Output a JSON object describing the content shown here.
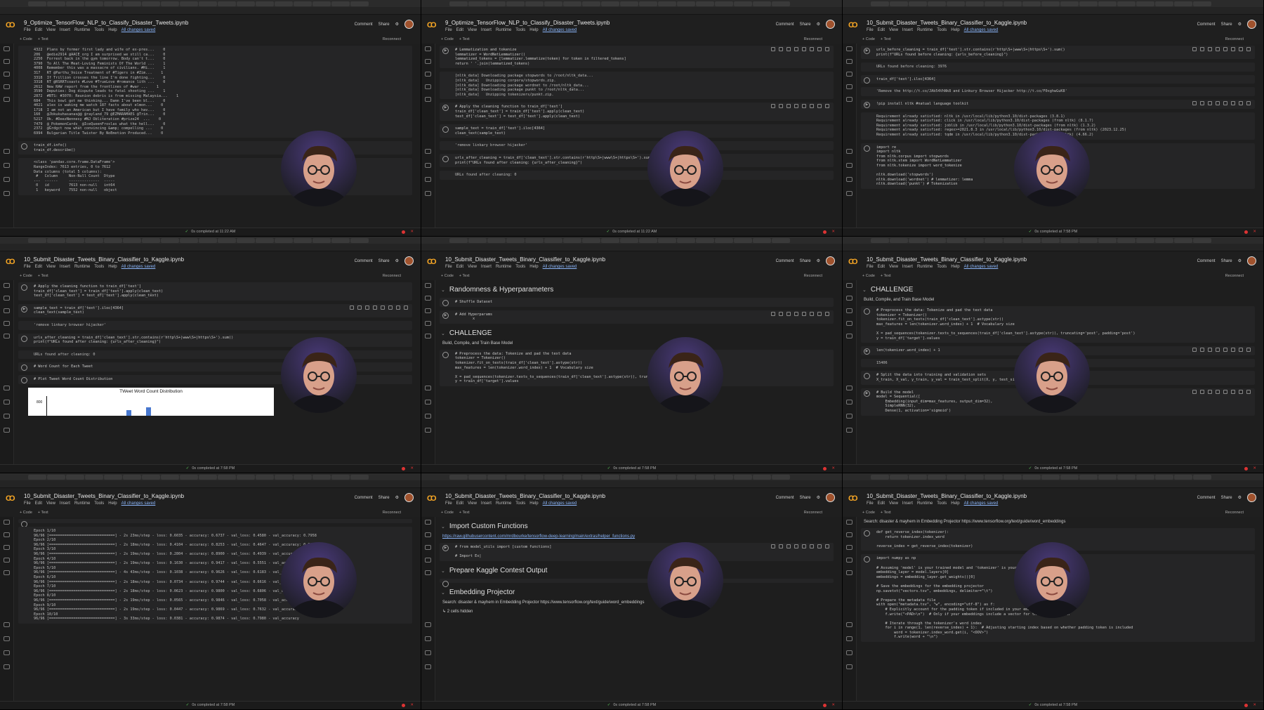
{
  "meta": {
    "screenshot": "grid of 9 Colab notebook windows"
  },
  "colors": {
    "accent_orange": "#f9a825",
    "link": "#8ab4f8",
    "status_ok": "#5fd35f",
    "status_error": "#d33333",
    "cam_bg": "#3a2a5a"
  },
  "common": {
    "menu": [
      "File",
      "Edit",
      "View",
      "Insert",
      "Runtime",
      "Tools",
      "Help"
    ],
    "saved": "All changes saved",
    "comment": "Comment",
    "share": "Share",
    "code_btn": "+ Code",
    "text_btn": "+ Text",
    "reconnect": "Reconnect"
  },
  "panels": [
    {
      "title": "9_Optimize_TensorFlow_NLP_to_Classify_Disaster_Tweets.ipynb",
      "status": "0s   completed at 11:22 AM",
      "cells": [
        {
          "type": "out",
          "text": "4322  Plans by former first lady and wife of ex-pres...    0\n206   @edie2914 @AACE_org I am surprised we still ca...    0\n2250  Forrest back in the gym tomorrow. Body can't t...    0\n3790  To All The Meat-Loving Feminists Of The World ...    1\n4008  Remember this was a massacre of civilians. #Hi...    1\n317   RT @Parthu_Voice Treatment of #Tigers in #Zim...    1\n3318  If Trillion crosses the line I'm done fighting...    0\n3318  RT @RSRRTcoasts #Love #TrueLove #romance lith ...    0\n2612  New RAW report from the frontlines of #war ...    1\n3590  Deputies: Dog dispute leads to fatal shooting ...    1\n2872  #BTS: #3070: Reunion debris is from missing Malaysia...    1\n684   This bowl got me thinking... Damn I've been bl...    0\n4021  alex is waking me watch 187 facts about elmon...    0\n1718  I am not an American but I have family who hav...    0\n160   @Jbkukuhasanas@@ @rayland_79 @EZMARAMAES @Trin...    0\n5217  Ok. #DeezNennesy #NJ Obliteration #prize24  ...    0\n7479  @_PokemonCards_ @IceQueenFroslas what the hell...    0\n2372  @Grdgct now what convincing &amp; compelling ...    0\n6994  Bulgarian Title Twister By NoEmotion Produced...    0"
        },
        {
          "type": "code",
          "text": "train_df.info()\ntrain_df.describe()"
        },
        {
          "type": "out",
          "text": "<class 'pandas.core.frame.DataFrame'>\nRangeIndex: 7613 entries, 0 to 7612\nData columns (total 5 columns):\n #   Column     Non-Null Count  Dtype\n---  ------     --------------  -----\n 0   id         7613 non-null   int64\n 1   keyword    7552 non-null   object"
        }
      ]
    },
    {
      "title": "9_Optimize_TensorFlow_NLP_to_Classify_Disaster_Tweets.ipynb",
      "status": "0s   completed at 11:22 AM",
      "cells": [
        {
          "type": "code",
          "run": true,
          "text": "# Lemmatization and tokenize\nlemmatizer = WordNetLemmatizer()\nlemmatized_tokens = [lemmatizer.lemmatize(token) for token in filtered_tokens]\nreturn ' '.join(lemmatized_tokens)"
        },
        {
          "type": "out",
          "text": "[nltk_data] Downloading package stopwords to /root/nltk_data...\n[nltk_data]   Unzipping corpora/stopwords.zip.\n[nltk_data] Downloading package wordnet to /root/nltk_data...\n[nltk_data] Downloading package punkt to /root/nltk_data...\n[nltk_data]   Unzipping tokenizers/punkt.zip."
        },
        {
          "type": "code",
          "run": true,
          "text": "# Apply the cleaning function to train_df['text']\ntrain_df['clean_text'] = train_df['text'].apply(clean_text)\ntest_df['clean_text'] = test_df['text'].apply(clean_text)"
        },
        {
          "type": "code",
          "text": "sample_text = train_df['text'].iloc[4364]\nclean_text(sample_text)"
        },
        {
          "type": "out",
          "text": "'remove linkary browser hijacker'"
        },
        {
          "type": "code",
          "text": "urls_after_cleaning = train_df['clean_text'].str.contains(r'http\\S+|www\\S+|https\\S+').sum()\nprint(f\"URLs found after cleaning: {urls_after_cleaning}\")"
        },
        {
          "type": "out",
          "text": "URLs found after cleaning: 0"
        }
      ]
    },
    {
      "title": "10_Submit_Disaster_Tweets_Binary_Classifier_to_Kaggle.ipynb",
      "status": "0s   completed at 7:58 PM",
      "cells": [
        {
          "type": "code",
          "run": true,
          "text": "urls_before_cleaning = train_df['text'].str.contains(r'http\\S+|www\\S+|https\\S+').sum()\nprint(f\"URLs found before cleaning: {urls_before_cleaning}\")"
        },
        {
          "type": "out",
          "text": "URLs found before cleaning: 3976"
        },
        {
          "type": "code",
          "text": "train_df['text'].iloc[4364]"
        },
        {
          "type": "out",
          "text": "'Remove the http://t.co/JAb54VhNk8 and Linkury Browser Hijacker http://t.co/F0xghwGuK8'"
        },
        {
          "type": "code",
          "run": true,
          "text": "!pip install nltk #natual language toolkit"
        },
        {
          "type": "out",
          "text": "Requirement already satisfied: nltk in /usr/local/lib/python3.10/dist-packages (3.8.1)\nRequirement already satisfied: click in /usr/local/lib/python3.10/dist-packages (from nltk) (8.1.7)\nRequirement already satisfied: joblib in /usr/local/lib/python3.10/dist-packages (from nltk) (1.3.2)\nRequirement already satisfied: regex>=2021.8.3 in /usr/local/lib/python3.10/dist-packages (from nltk) (2023.12.25)\nRequirement already satisfied: tqdm in /usr/local/lib/python3.10/dist-packages (from nltk) (4.66.2)"
        },
        {
          "type": "code",
          "text": "import re\nimport nltk\nfrom nltk.corpus import stopwords\nfrom nltk.stem import WordNetLemmatizer\nfrom nltk.tokenize import word_tokenize\n\nnltk.download('stopwords')\nnltk.download('wordnet') # lemmatizer: lemma\nnltk.download('punkt') # Tokenization"
        }
      ]
    },
    {
      "title": "10_Submit_Disaster_Tweets_Binary_Classifier_to_Kaggle.ipynb",
      "status": "0s   completed at 7:58 PM",
      "chart": {
        "title": "TWeet Word Count Distribution",
        "ytick": "800"
      },
      "cells": [
        {
          "type": "code",
          "text": "# Apply the cleaning function to train_df['text']\ntrain_df['clean_text'] = train_df['text'].apply(clean_text)\ntest_df['clean_text'] = test_df['text'].apply(clean_text)"
        },
        {
          "type": "code",
          "run": true,
          "text": "sample_text = train_df['text'].iloc[4364]\nclean_text(sample_text)"
        },
        {
          "type": "out",
          "text": "'remove linkary browser hijacker'"
        },
        {
          "type": "code",
          "text": "urls_after_cleaning = train_df['clean_text'].str.contains(r'http\\S+|www\\S+|https\\S+').sum()\nprint(f\"URLs found after cleaning: {urls_after_cleaning}\")"
        },
        {
          "type": "out",
          "text": "URLs found after cleaning: 0"
        },
        {
          "type": "code",
          "text": "# Word Count for Each Tweet"
        },
        {
          "type": "code",
          "text": "# Plot Tweet Word Count Distribution"
        }
      ]
    },
    {
      "title": "10_Submit_Disaster_Tweets_Binary_Classifier_to_Kaggle.ipynb",
      "status": "0s   completed at 7:58 PM",
      "cells": [
        {
          "type": "h",
          "text": "Randomness & Hyperparameters"
        },
        {
          "type": "code",
          "text": "# Shuffle Dataset"
        },
        {
          "type": "code",
          "run": true,
          "text": "# Add Hyperparams\n        x"
        },
        {
          "type": "h",
          "text": "CHALLENGE"
        },
        {
          "type": "p",
          "text": "Build, Compile, and Train Base Model"
        },
        {
          "type": "code",
          "text": "# Preprocess the data: Tokenize and pad the text data\ntokenizer = Tokenizer()\ntokenizer.fit_on_texts(train_df['clean_text'].astype(str))\nmax_features = len(tokenizer.word_index) + 1  # Vocabulary size\n\nX = pad_sequences(tokenizer.texts_to_sequences(train_df['clean_text'].astype(str)), truncating='post', padding=\ny = train_df['target'].values"
        }
      ]
    },
    {
      "title": "10_Submit_Disaster_Tweets_Binary_Classifier_to_Kaggle.ipynb",
      "status": "0s   completed at 7:58 PM",
      "cells": [
        {
          "type": "h",
          "text": "CHALLENGE"
        },
        {
          "type": "p",
          "text": "Build, Compile, and Train Base Model"
        },
        {
          "type": "code",
          "text": "# Preprocess the data: Tokenize and pad the text data\ntokenizer = Tokenizer()\ntokenizer.fit_on_texts(train_df['clean_text'].astype(str))\nmax_features = len(tokenizer.word_index) + 1  # Vocabulary size\n\nX = pad_sequences(tokenizer.texts_to_sequences(train_df['clean_text'].astype(str)), truncating='post', padding='post')\ny = train_df['target'].values"
        },
        {
          "type": "code",
          "run": true,
          "text": "len(tokenizer.word_index) + 1"
        },
        {
          "type": "out",
          "text": "15406"
        },
        {
          "type": "code",
          "text": "# Split the data into training and validation sets\nX_train, X_val, y_train, y_val = train_test_split(X, y, test_size=0.2, random_state=42)"
        },
        {
          "type": "code",
          "run": true,
          "text": "# Build the model\nmodel = Sequential([\n    Embedding(input_dim=max_features, output_dim=32),\n    SimpleRNN(32),\n    Dense(1, activation='sigmoid')"
        }
      ]
    },
    {
      "title": "10_Submit_Disaster_Tweets_Binary_Classifier_to_Kaggle.ipynb",
      "status": "0s   completed at 7:58 PM",
      "cells": [
        {
          "type": "code",
          "text": ""
        },
        {
          "type": "out",
          "text": "Epoch 1/10\n96/96 [==============================] - 2s 23ms/step - loss: 0.6035 - accuracy: 0.6737 - val_loss: 0.4580 - val_accuracy: 0.7958\nEpoch 2/10\n96/96 [==============================] - 2s 18ms/step - loss: 0.4104 - accuracy: 0.8253 - val_loss: 0.4647 - val_accuracy: 0.8043\nEpoch 3/10\n96/96 [==============================] - 2s 19ms/step - loss: 0.2804 - accuracy: 0.8900 - val_loss: 0.4939 - val_accuracy: 0.7840\nEpoch 4/10\n96/96 [==============================] - 2s 19ms/step - loss: 0.1630 - accuracy: 0.9417 - val_loss: 0.5551 - val_accuracy: 0.7886\nEpoch 5/10\n96/96 [==============================] - 4s 43ms/step - loss: 0.1038 - accuracy: 0.9626 - val_loss: 0.6183 - val_accuracy: 0.7814\nEpoch 6/10\n96/96 [==============================] - 2s 18ms/step - loss: 0.0734 - accuracy: 0.9744 - val_loss: 0.6616 - val_accuracy\nEpoch 7/10\n96/96 [==============================] - 2s 18ms/step - loss: 0.0623 - accuracy: 0.9800 - val_loss: 0.6806 - val_accuracy\nEpoch 8/10\n96/96 [==============================] - 2s 19ms/step - loss: 0.0565 - accuracy: 0.9846 - val_loss: 0.7058 - val_accuracy\nEpoch 9/10\n96/96 [==============================] - 2s 19ms/step - loss: 0.0447 - accuracy: 0.9869 - val_loss: 0.7632 - val_accuracy\nEpoch 10/10\n96/96 [==============================] - 3s 33ms/step - loss: 0.0381 - accuracy: 0.9874 - val_loss: 0.7980 - val_accuracy"
        }
      ]
    },
    {
      "title": "10_Submit_Disaster_Tweets_Binary_Classifier_to_Kaggle.ipynb",
      "status": "0s   completed at 7:58 PM",
      "cells": [
        {
          "type": "h",
          "text": "Import Custom Functions"
        },
        {
          "type": "link",
          "text": "https://raw.githubusercontent.com/mrdbourke/tensorflow-deep-learning/main/extras/helper_functions.py"
        },
        {
          "type": "code",
          "run": true,
          "text": "# from model_utils import [custom functions]\n\n# Import Ex|"
        },
        {
          "type": "h",
          "text": "Prepare Kaggle Contest Output"
        },
        {
          "type": "code",
          "text": ""
        },
        {
          "type": "h",
          "text": "Embedding Projector"
        },
        {
          "type": "p",
          "text": "Search: disaster & mayhem in Embedding Projector https://www.tensorflow.org/text/guide/word_embeddings"
        },
        {
          "type": "p",
          "text": "↳ 2 cells hidden"
        }
      ]
    },
    {
      "title": "10_Submit_Disaster_Tweets_Binary_Classifier_to_Kaggle.ipynb",
      "status": "0s   completed at 7:58 PM",
      "cells": [
        {
          "type": "p",
          "text": "Search: disaster & mayhem in Embedding Projector https://www.tensorflow.org/text/guide/word_embeddings"
        },
        {
          "type": "code",
          "text": "def get_reverse_index(tokenizer):\n    return tokenizer.index_word\n\nreverse_index = get_reverse_index(tokenizer)"
        },
        {
          "type": "code",
          "text": "import numpy as np\n\n# Assuming 'model' is your trained model and 'tokenizer' is your tokenizer.\nembedding_layer = model.layers[0]\nembeddings = embedding_layer.get_weights()[0]\n\n# Save the embeddings for the embedding projector\nnp.savetxt(\"vectors.tsv\", embeddings, delimiter=\"\\t\")\n\n# Prepare the metadata file\nwith open(\"metadata.tsv\", \"w\", encoding=\"utf-8\") as f:\n    # Explicitly account for the padding token if included in your embeddings\n    f.write(\"<PAD>\\n\")  # Only if your embeddings include a vector for the padding token\n\n    # Iterate through the tokenizer's word index\n    for i in range(1, len(reverse_index) + 1):  # Adjusting starting index based on whether padding token is included\n        word = tokenizer.index_word.get(i, \"<OOV>\")\n        f.write(word + \"\\n\")"
        }
      ]
    }
  ]
}
